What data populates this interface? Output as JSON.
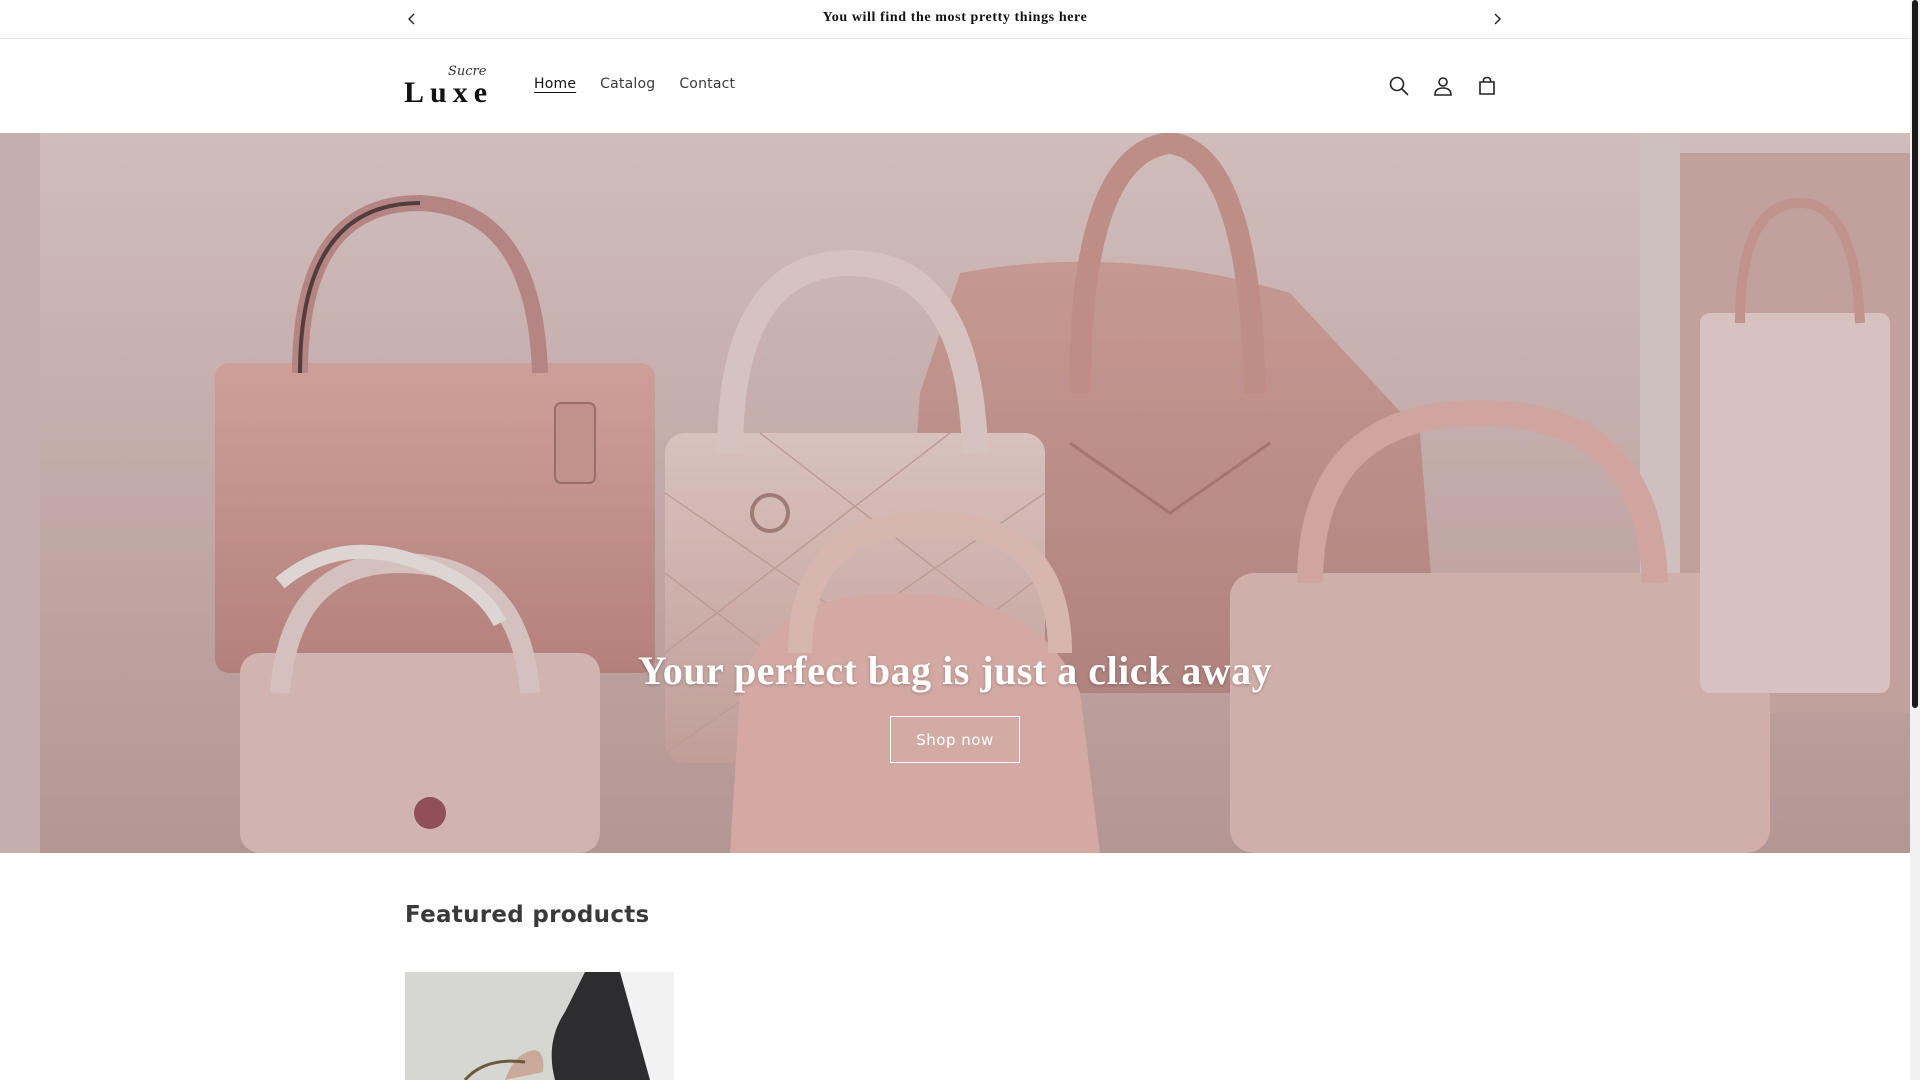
{
  "announcement": {
    "text": "You will find the most pretty things here",
    "prev_icon": "chevron-left-icon",
    "next_icon": "chevron-right-icon"
  },
  "header": {
    "logo": {
      "script": "Sucre",
      "word": "Luxe"
    },
    "nav": [
      {
        "label": "Home",
        "active": true
      },
      {
        "label": "Catalog",
        "active": false
      },
      {
        "label": "Contact",
        "active": false
      }
    ],
    "icons": [
      "search-icon",
      "account-icon",
      "cart-icon"
    ]
  },
  "hero": {
    "headline": "Your perfect bag is just a click away",
    "cta": "Shop now"
  },
  "featured": {
    "title": "Featured products"
  },
  "colors": {
    "accent_text": "#121212",
    "hero_tint": "#d9b3ad",
    "bag_pink": "#e8b5ae"
  }
}
